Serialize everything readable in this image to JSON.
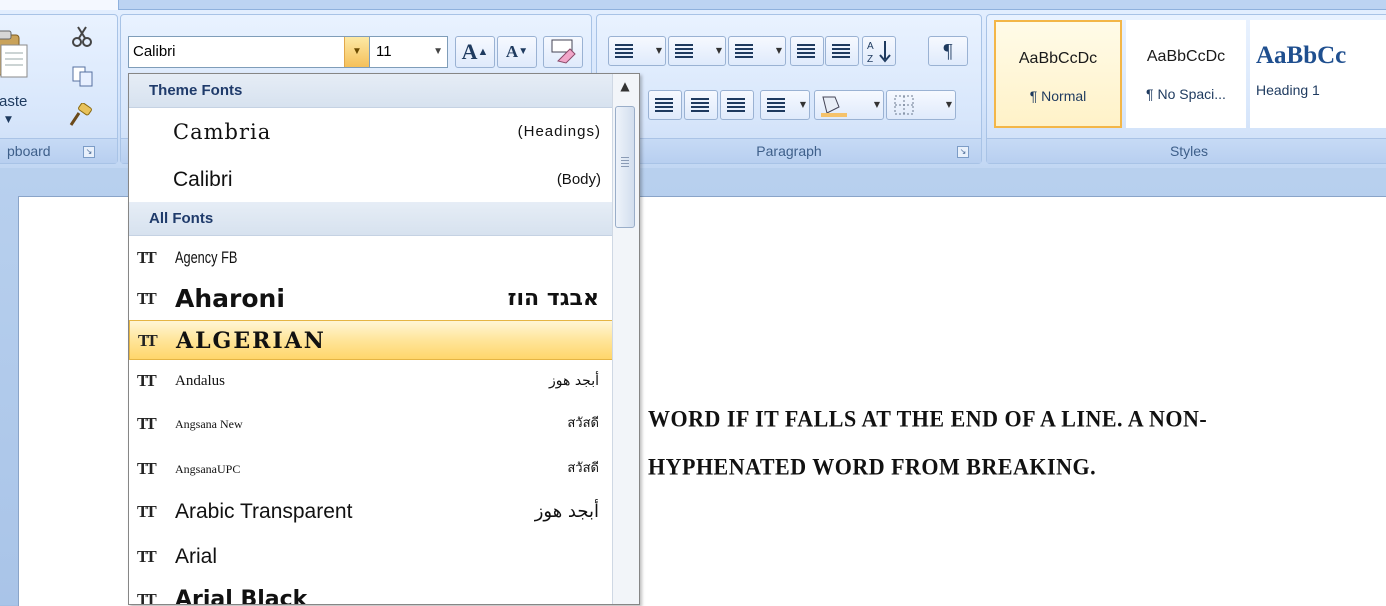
{
  "ribbon": {
    "clipboard": {
      "label": "pboard",
      "paste_label": "Paste"
    },
    "font": {
      "current_font": "Calibri",
      "current_size": "11"
    },
    "paragraph": {
      "label": "Paragraph"
    },
    "styles": {
      "label": "Styles",
      "items": [
        {
          "sample": "AaBbCcDc",
          "name": "¶ Normal"
        },
        {
          "sample": "AaBbCcDc",
          "name": "¶ No Spaci..."
        },
        {
          "sample": "AaBbCc",
          "name": "Heading 1"
        }
      ]
    }
  },
  "font_dropdown": {
    "theme_header": "Theme Fonts",
    "theme_fonts": [
      {
        "name": "Cambria",
        "role": "(Headings)"
      },
      {
        "name": "Calibri",
        "role": "(Body)"
      }
    ],
    "all_header": "All Fonts",
    "fonts": [
      {
        "name": "Agency FB",
        "sample": ""
      },
      {
        "name": "Aharoni",
        "sample": "אבגד הוז"
      },
      {
        "name": "ALGERIAN",
        "sample": ""
      },
      {
        "name": "Andalus",
        "sample": "أبجد هوز"
      },
      {
        "name": "Angsana New",
        "sample": "สวัสดี"
      },
      {
        "name": "AngsanaUPC",
        "sample": "สวัสดี"
      },
      {
        "name": "Arabic Transparent",
        "sample": "أبجد هوز"
      },
      {
        "name": "Arial",
        "sample": ""
      },
      {
        "name": "Arial Black",
        "sample": ""
      }
    ]
  },
  "document": {
    "lines": [
      "WORD IF IT FALLS AT THE END OF A LINE. A NON-",
      "HYPHENATED WORD FROM BREAKING."
    ]
  }
}
